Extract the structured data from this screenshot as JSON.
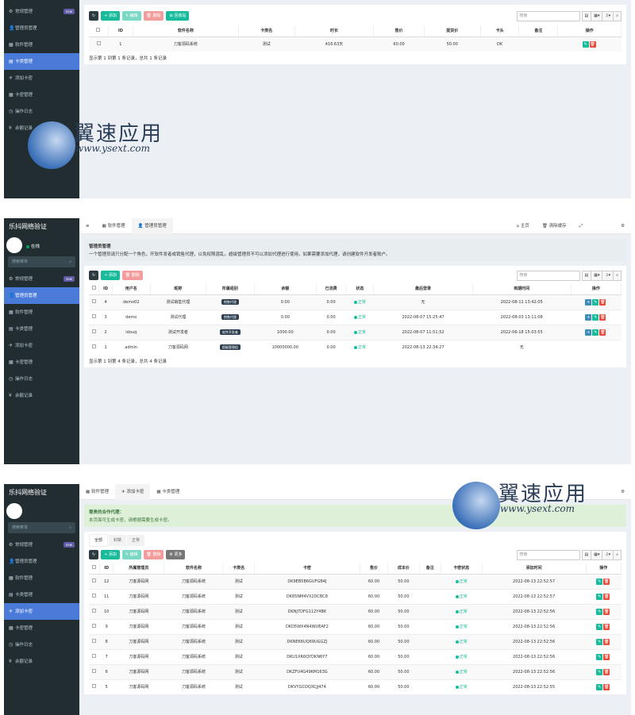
{
  "app_title": "乐抖网络验证",
  "online_label": "在线",
  "search_menu_placeholder": "搜索菜单",
  "new_badge": "new",
  "menu": [
    "常规管理",
    "管理员管理",
    "软件管理",
    "卡类管理",
    "添加卡密",
    "卡密管理",
    "操作日志",
    "余额记录"
  ],
  "watermark": {
    "text": "翼速应用",
    "url": "www.ysext.com"
  },
  "toolbar": {
    "refresh": "↻",
    "add": "+ 添加",
    "edit": "✎ 编辑",
    "delete": "🗑 删除",
    "recycle": "♻ 回收站",
    "more": "⚙ 更多",
    "search_placeholder": "搜索"
  },
  "panel1": {
    "headers": [
      "ID",
      "软件名称",
      "卡类名",
      "时长",
      "售价",
      "提货价",
      "卡头",
      "备注",
      "操作"
    ],
    "rows": [
      [
        "1",
        "刀客源码系统",
        "测试",
        "416.63天",
        "60.00",
        "50.00",
        "DK",
        ""
      ]
    ],
    "footer": "显示第 1 到第 1 条记录，总共 1 条记录"
  },
  "panel2": {
    "tabs": [
      "软件管理",
      "管理员管理"
    ],
    "right_links": [
      "主页",
      "清除缓存"
    ],
    "notice_title": "管理员管理",
    "notice_body": "一个管理员请只分配一个角色，开软件发者或销售代理，以免权限混乱。超级管理员不可以添加代理进行使用，如果需要添加代理，请创建软件开发者账户。",
    "headers": [
      "ID",
      "用户名",
      "昵称",
      "所属组别",
      "余额",
      "已消费",
      "状态",
      "最后登录",
      "到期时间",
      "操作"
    ],
    "rows": [
      [
        "4",
        "demo02",
        "测试销售代理",
        "销售代理",
        "0.00",
        "0.00",
        "正常",
        "无",
        "2022-08-11 13:42:05"
      ],
      [
        "3",
        "demo",
        "测试代理",
        "销售代理",
        "0.00",
        "0.00",
        "正常",
        "2022-08-07 15:25:47",
        "2022-08-03 13:11:08"
      ],
      [
        "2",
        "idouq",
        "测试开发者",
        "软件开发者",
        "1000.00",
        "0.00",
        "正常",
        "2022-08-07 11:51:52",
        "2022-06-18 15:03:55"
      ],
      [
        "1",
        "admin",
        "刀客源码网",
        "超级管理组",
        "10000000.00",
        "0.00",
        "正常",
        "2022-08-13 22:34:27",
        "无"
      ]
    ],
    "footer": "显示第 1 到第 4 条记录，总共 4 条记录"
  },
  "panel3": {
    "tabs": [
      "软件管理",
      "添加卡密",
      "卡类管理"
    ],
    "notice_title": "尊贵的合作代理：",
    "notice_body": "本页面可生成卡密，请根据需要生成卡密。",
    "subtabs": [
      "全部",
      "封禁",
      "正常"
    ],
    "headers": [
      "ID",
      "所属管理员",
      "软件名称",
      "卡类名",
      "卡密",
      "售价",
      "成本价",
      "备注",
      "卡密状态",
      "添加时间",
      "操作"
    ],
    "rows": [
      [
        "12",
        "刀客源码网",
        "刀客源码系统",
        "测试",
        "DK9EB5B6GUFGB4J",
        "60.00",
        "50.00",
        "",
        "正常",
        "2022-08-13 22:52:57"
      ],
      [
        "11",
        "刀客源码网",
        "刀客源码系统",
        "测试",
        "DK65NM4VX2DCBC8",
        "60.00",
        "50.00",
        "",
        "正常",
        "2022-08-13 22:52:57"
      ],
      [
        "10",
        "刀客源码网",
        "刀客源码系统",
        "测试",
        "DKNJ7DFG112Y4BK",
        "60.00",
        "50.00",
        "",
        "正常",
        "2022-08-13 22:52:56"
      ],
      [
        "9",
        "刀客源码网",
        "刀客源码系统",
        "测试",
        "DKD5WX4N4WUEAF2",
        "60.00",
        "50.00",
        "",
        "正常",
        "2022-08-13 22:52:56"
      ],
      [
        "8",
        "刀客源码网",
        "刀客源码系统",
        "测试",
        "DKNEK6UQ69UGGZJ",
        "60.00",
        "50.00",
        "",
        "正常",
        "2022-08-13 22:52:56"
      ],
      [
        "7",
        "刀客源码网",
        "刀客源码系统",
        "测试",
        "DKU1XR6QYDKN6Y7",
        "60.00",
        "50.00",
        "",
        "正常",
        "2022-08-13 22:52:56"
      ],
      [
        "6",
        "刀客源码网",
        "刀客源码系统",
        "测试",
        "DKZFU4G49KM163G",
        "60.00",
        "50.00",
        "",
        "正常",
        "2022-08-13 22:52:56"
      ],
      [
        "5",
        "刀客源码网",
        "刀客源码系统",
        "测试",
        "DKVYGCDQXCJJ474",
        "60.00",
        "50.00",
        "",
        "正常",
        "2022-08-13 22:52:55"
      ]
    ]
  }
}
